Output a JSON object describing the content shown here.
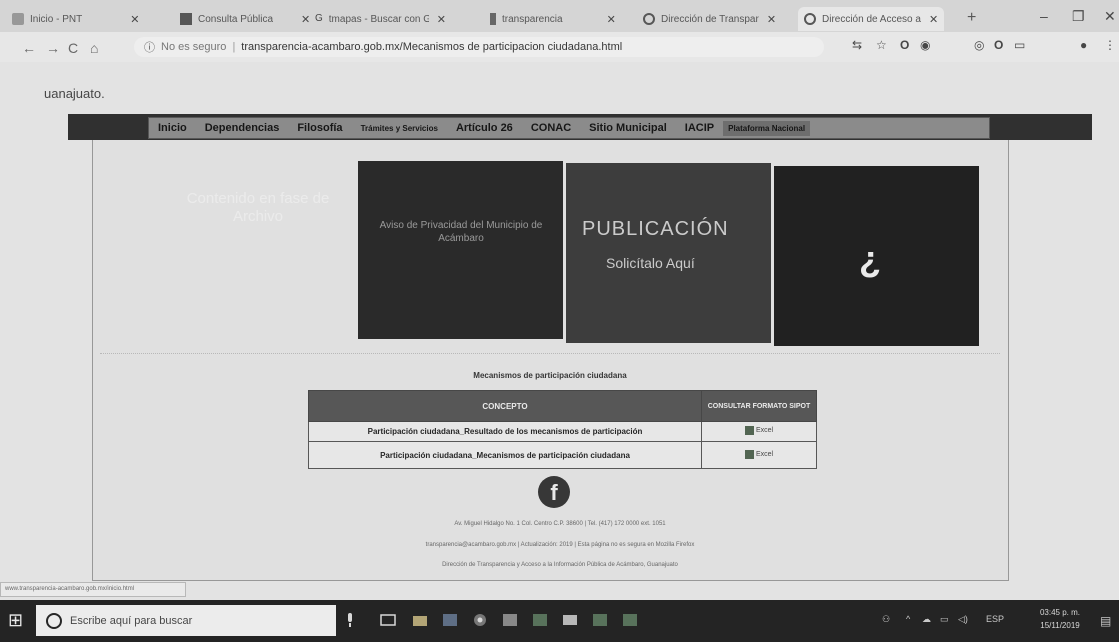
{
  "tabs": [
    {
      "label": "Inicio - PNT"
    },
    {
      "label": "Consulta Pública"
    },
    {
      "label": "tmapas - Buscar con G"
    },
    {
      "label": "transparencia"
    },
    {
      "label": "Dirección de Transpar"
    },
    {
      "label": "Dirección de Acceso a"
    }
  ],
  "address": {
    "security": "No es seguro",
    "url": "transparencia-acambaro.gob.mx/Mecanismos de participacion ciudadana.html"
  },
  "page": {
    "location_text": "uanajuato.",
    "nav": [
      {
        "label": "Inicio"
      },
      {
        "label": "Dependencias"
      },
      {
        "label": "Filosofía"
      },
      {
        "label": "Trámites y Servicios"
      },
      {
        "label": "Artículo 26"
      },
      {
        "label": "CONAC"
      },
      {
        "label": "Sitio Municipal"
      },
      {
        "label": "IACIP"
      },
      {
        "label": "Plataforma Nacional"
      }
    ],
    "hero_text": "Contenido en fase de Archivo",
    "tile1_text": "Aviso de Privacidad del Municipio de Acámbaro",
    "tile2_line1": "PUBLICACIÓN",
    "tile2_line2": "Solicítalo Aquí",
    "tile3_symbol": "¿",
    "section_title": "Mecanismos de participación ciudadana",
    "table": {
      "header_concept": "CONCEPTO",
      "header_consult": "CONSULTAR FORMATO SIPOT",
      "rows": [
        {
          "concept": "Participación ciudadana_Resultado de los mecanismos de participación",
          "link": "Excel"
        },
        {
          "concept": "Participación ciudadana_Mecanismos de participación ciudadana",
          "link": "Excel"
        }
      ]
    },
    "footer_line1": "Av. Miguel Hidalgo No. 1 Col. Centro C.P. 38600 | Tel. (417) 172 0000 ext. 1051",
    "footer_line2": "transparencia@acambaro.gob.mx | Actualización: 2019 | Esta página no es segura en Mozilla Firefox",
    "footer_line3": "Dirección de Transparencia y Acceso a la Información Pública de Acámbaro, Guanajuato",
    "status_url": "www.transparencia-acambaro.gob.mx/inicio.html"
  },
  "taskbar": {
    "search_placeholder": "Escribe aquí para buscar",
    "time": "03:45 p. m.",
    "date": "15/11/2019",
    "lang": "ESP"
  }
}
